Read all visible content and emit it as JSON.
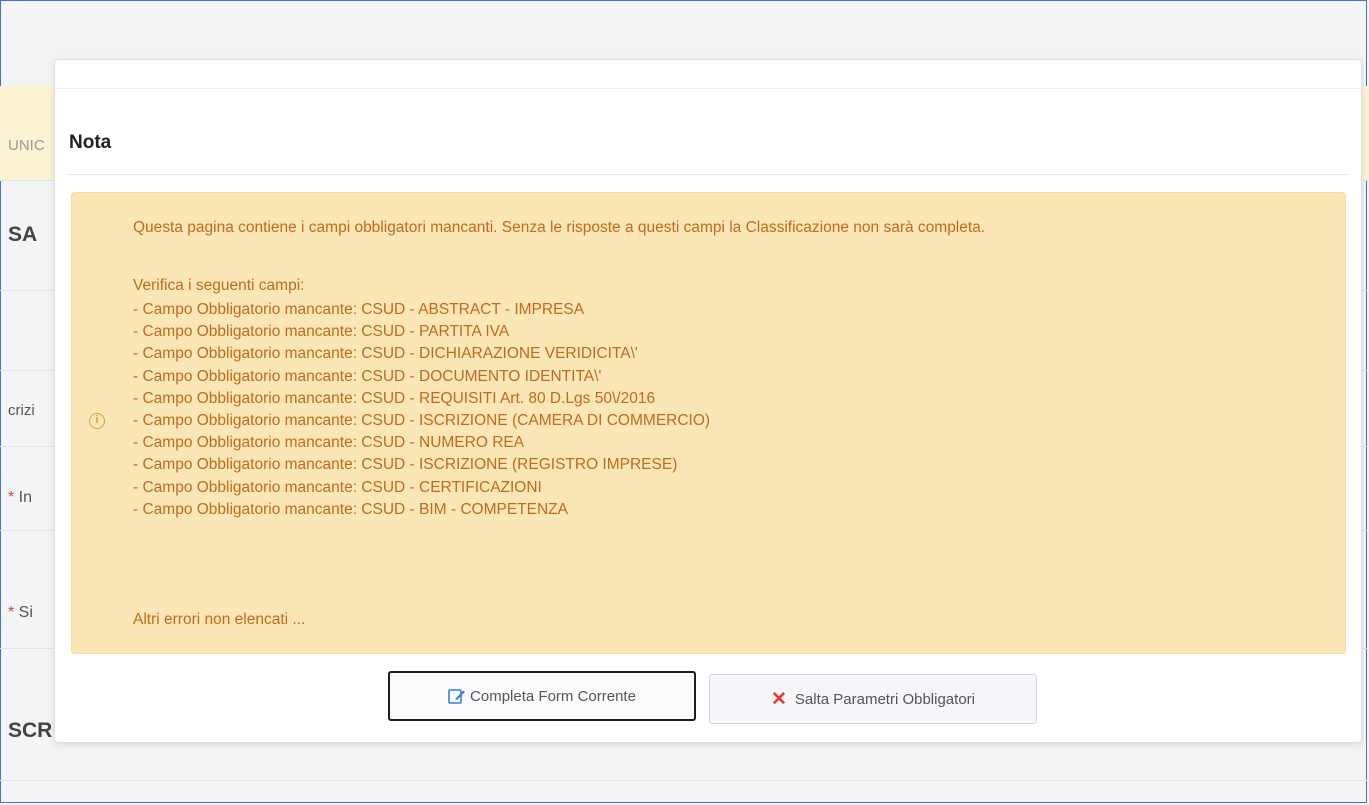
{
  "background": {
    "frag_1": "UNIC",
    "frag_2": "SA",
    "frag_3": "crizi",
    "frag_4_mark": "*",
    "frag_4": " In",
    "frag_5_mark": "*",
    "frag_5": " Si",
    "frag_6": "SCR"
  },
  "modal": {
    "title": "Nota",
    "alert": {
      "icon": "info-circle-icon",
      "intro": "Questa pagina contiene i campi obbligatori mancanti. Senza le risposte a questi campi la Classificazione non sarà completa.",
      "verify_label": "Verifica i seguenti campi:",
      "items": [
        "- Campo Obbligatorio mancante: CSUD - ABSTRACT - IMPRESA",
        "- Campo Obbligatorio mancante: CSUD - PARTITA IVA",
        "- Campo Obbligatorio mancante: CSUD - DICHIARAZIONE VERIDICITA\\'",
        "- Campo Obbligatorio mancante: CSUD - DOCUMENTO IDENTITA\\'",
        "- Campo Obbligatorio mancante: CSUD - REQUISITI Art. 80 D.Lgs 50\\/2016",
        "- Campo Obbligatorio mancante: CSUD - ISCRIZIONE (CAMERA DI COMMERCIO)",
        "- Campo Obbligatorio mancante: CSUD - NUMERO REA",
        "- Campo Obbligatorio mancante: CSUD - ISCRIZIONE (REGISTRO IMPRESE)",
        "- Campo Obbligatorio mancante: CSUD - CERTIFICAZIONI",
        "- Campo Obbligatorio mancante: CSUD - BIM - COMPETENZA"
      ],
      "more": "Altri errori non elencati ..."
    },
    "buttons": {
      "complete_label": "Completa Form Corrente",
      "complete_icon": "edit-form-icon",
      "skip_label": "Salta Parametri Obbligatori",
      "skip_icon": "close-x-icon"
    }
  },
  "colors": {
    "alert_bg": "#fbe7b5",
    "alert_text": "#c2691e",
    "skip_icon": "#e53935",
    "edit_icon": "#3b7ddd"
  }
}
